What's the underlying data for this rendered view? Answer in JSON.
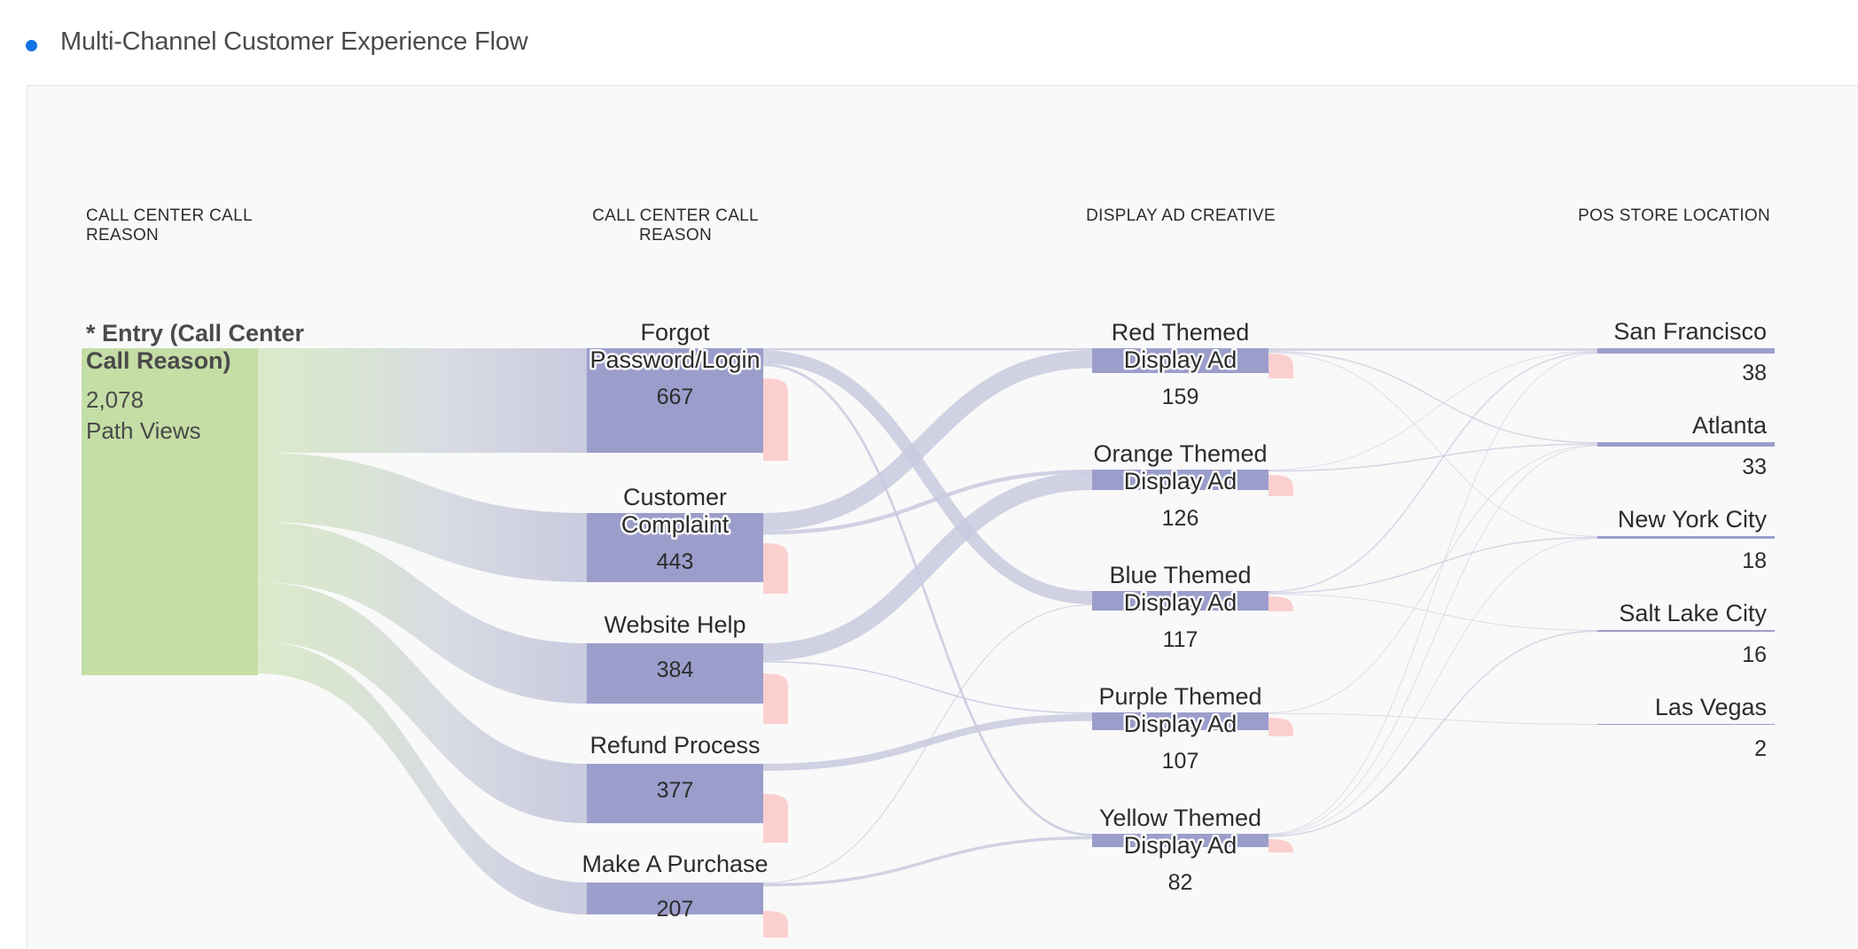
{
  "panel": {
    "title": "Multi-Channel Customer Experience Flow"
  },
  "colors": {
    "accent_dot": "#1473e6",
    "entry_node": "#c4dea6",
    "node": "#9b9dcb",
    "exit_marker": "#fccfcf",
    "link": "#c9cadf",
    "background": "#f9f9f9"
  },
  "chart_data": {
    "type": "sankey",
    "columns": [
      {
        "header": "CALL CENTER CALL\nREASON",
        "nodes": [
          {
            "id": "entry",
            "label": "* Entry (Call Center\nCall Reason)",
            "value": "2,078",
            "value_label": "Path Views"
          }
        ]
      },
      {
        "header": "CALL CENTER CALL\nREASON",
        "nodes": [
          {
            "id": "forgot",
            "label": "Forgot\nPassword/Login",
            "value": "667"
          },
          {
            "id": "complaint",
            "label": "Customer\nComplaint",
            "value": "443"
          },
          {
            "id": "website",
            "label": "Website Help",
            "value": "384"
          },
          {
            "id": "refund",
            "label": "Refund Process",
            "value": "377"
          },
          {
            "id": "purchase",
            "label": "Make A Purchase",
            "value": "207"
          }
        ]
      },
      {
        "header": "DISPLAY AD CREATIVE",
        "nodes": [
          {
            "id": "red",
            "label": "Red Themed\nDisplay Ad",
            "value": "159"
          },
          {
            "id": "orange",
            "label": "Orange Themed\nDisplay Ad",
            "value": "126"
          },
          {
            "id": "blue",
            "label": "Blue Themed\nDisplay Ad",
            "value": "117"
          },
          {
            "id": "purple",
            "label": "Purple Themed\nDisplay Ad",
            "value": "107"
          },
          {
            "id": "yellow",
            "label": "Yellow Themed\nDisplay Ad",
            "value": "82"
          }
        ]
      },
      {
        "header": "POS STORE LOCATION",
        "nodes": [
          {
            "id": "sf",
            "label": "San Francisco",
            "value": "38"
          },
          {
            "id": "atl",
            "label": "Atlanta",
            "value": "33"
          },
          {
            "id": "nyc",
            "label": "New York City",
            "value": "18"
          },
          {
            "id": "slc",
            "label": "Salt Lake City",
            "value": "16"
          },
          {
            "id": "lv",
            "label": "Las Vegas",
            "value": "2"
          }
        ]
      }
    ],
    "links": [
      {
        "source": "entry",
        "target": "forgot",
        "value": 667
      },
      {
        "source": "entry",
        "target": "complaint",
        "value": 443
      },
      {
        "source": "entry",
        "target": "website",
        "value": 384
      },
      {
        "source": "entry",
        "target": "refund",
        "value": 377
      },
      {
        "source": "entry",
        "target": "purchase",
        "value": 207
      },
      {
        "source": "forgot",
        "target": "red",
        "value": 12
      },
      {
        "source": "forgot",
        "target": "blue",
        "value": 75
      },
      {
        "source": "forgot",
        "target": "yellow",
        "value": 14
      },
      {
        "source": "complaint",
        "target": "red",
        "value": 100
      },
      {
        "source": "complaint",
        "target": "orange",
        "value": 22
      },
      {
        "source": "website",
        "target": "orange",
        "value": 100
      },
      {
        "source": "website",
        "target": "purple",
        "value": 8
      },
      {
        "source": "refund",
        "target": "purple",
        "value": 40
      },
      {
        "source": "purchase",
        "target": "blue",
        "value": 1
      },
      {
        "source": "purchase",
        "target": "yellow",
        "value": 17
      },
      {
        "source": "red",
        "target": "sf",
        "value": 4
      },
      {
        "source": "red",
        "target": "atl",
        "value": 2
      },
      {
        "source": "red",
        "target": "nyc",
        "value": 1
      },
      {
        "source": "orange",
        "target": "sf",
        "value": 1
      },
      {
        "source": "orange",
        "target": "atl",
        "value": 2
      },
      {
        "source": "blue",
        "target": "sf",
        "value": 2
      },
      {
        "source": "blue",
        "target": "nyc",
        "value": 2
      },
      {
        "source": "blue",
        "target": "slc",
        "value": 1
      },
      {
        "source": "purple",
        "target": "atl",
        "value": 1
      },
      {
        "source": "purple",
        "target": "lv",
        "value": 1
      },
      {
        "source": "yellow",
        "target": "sf",
        "value": 1
      },
      {
        "source": "yellow",
        "target": "atl",
        "value": 1
      },
      {
        "source": "yellow",
        "target": "nyc",
        "value": 1
      },
      {
        "source": "yellow",
        "target": "slc",
        "value": 2
      }
    ]
  }
}
